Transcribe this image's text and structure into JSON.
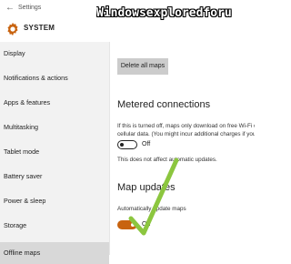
{
  "window": {
    "title": "Settings",
    "back_icon": "back-arrow-icon"
  },
  "header": {
    "icon": "gear-icon",
    "title": "SYSTEM"
  },
  "watermark": "Windowsexploredforu",
  "sidebar": {
    "items": [
      {
        "label": "Display"
      },
      {
        "label": "Notifications & actions"
      },
      {
        "label": "Apps & features"
      },
      {
        "label": "Multitasking"
      },
      {
        "label": "Tablet mode"
      },
      {
        "label": "Battery saver"
      },
      {
        "label": "Power & sleep"
      },
      {
        "label": "Storage"
      },
      {
        "label": "Offline maps",
        "selected": true
      }
    ]
  },
  "main": {
    "delete_button": "Delete all maps",
    "metered": {
      "heading": "Metered connections",
      "description": "If this is turned off, maps only download on free Wi-Fi or u cellular data. (You might incur additional charges if you tur",
      "toggle_label": "Off",
      "toggle_state": "off",
      "note": "This does not affect automatic updates."
    },
    "updates": {
      "heading": "Map updates",
      "sublabel": "Automatically update maps",
      "toggle_label": "On",
      "toggle_state": "on"
    }
  },
  "colors": {
    "accent": "#c8630f",
    "sidebar_bg": "#f2f2f2",
    "selected_bg": "#d8d8d8",
    "annotation_check": "#8cc63f"
  }
}
